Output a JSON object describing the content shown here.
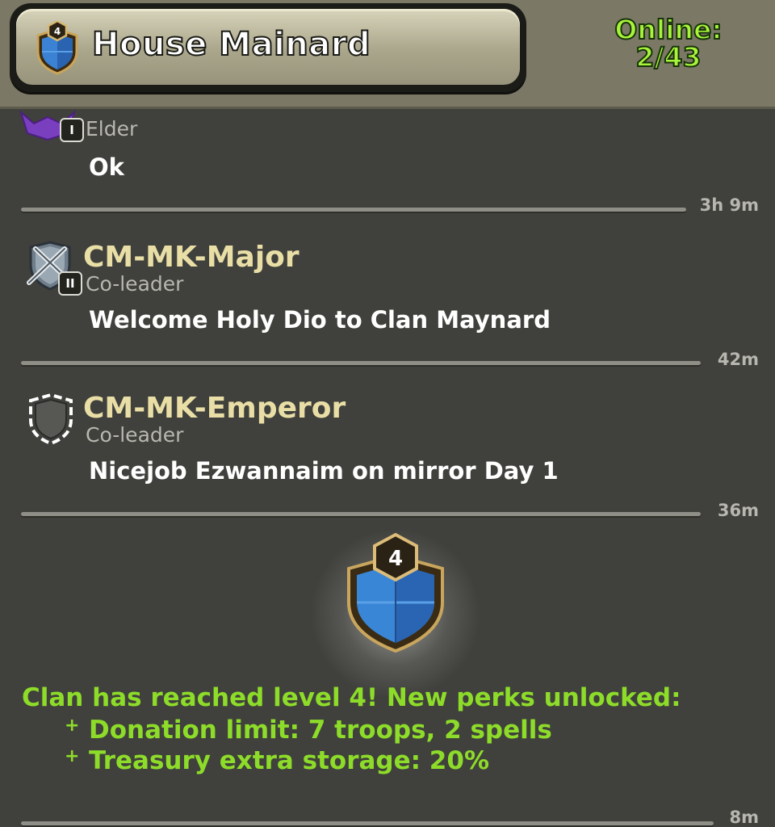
{
  "header": {
    "clan_level": "4",
    "clan_name": "House Mainard",
    "online_label": "Online:",
    "online_count": "2/43"
  },
  "messages": [
    {
      "role": "Elder",
      "rank": "I",
      "text": "Ok",
      "time": "3h 9m"
    },
    {
      "name": "CM-MK-Major",
      "role": "Co-leader",
      "rank": "II",
      "text": "Welcome Holy Dio to Clan Maynard",
      "time": "42m"
    },
    {
      "name": "CM-MK-Emperor",
      "role": "Co-leader",
      "text": "Nicejob Ezwannaim on mirror Day 1",
      "time": "36m"
    }
  ],
  "level_up": {
    "badge_level": "4",
    "headline": "Clan has reached level 4! New perks unlocked:",
    "perk_bullet": "+",
    "perks": [
      "Donation limit: 7 troops, 2 spells",
      "Treasury extra storage: 20%"
    ],
    "time": "8m"
  },
  "colors": {
    "accent_green": "#8ddc2a",
    "name_gold": "#e8dea6",
    "background": "#40403c",
    "header": "#7b7865"
  },
  "icons": [
    "clan-badge-icon",
    "league-badge-icon",
    "crossed-swords-shield-icon",
    "empty-shield-icon"
  ]
}
